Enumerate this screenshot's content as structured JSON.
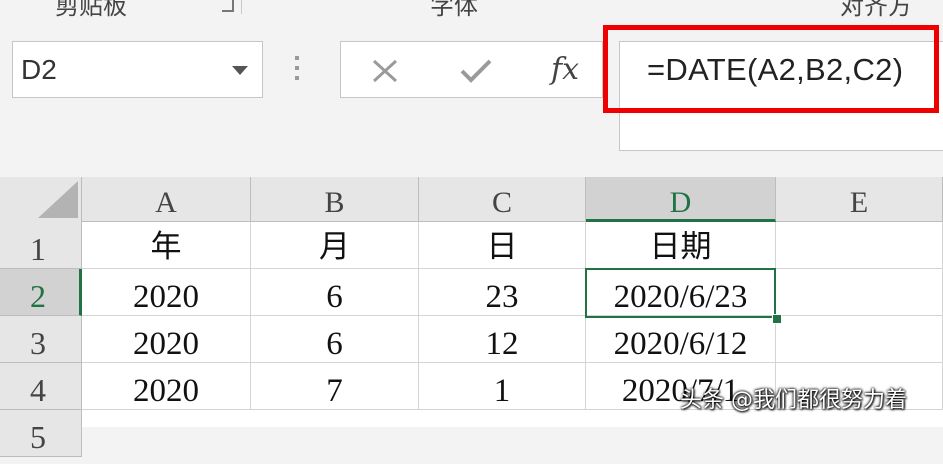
{
  "ribbon": {
    "group_clipboard": "剪贴板",
    "group_font": "字体",
    "group_align": "对齐方"
  },
  "name_box": {
    "value": "D2"
  },
  "formula_bar": {
    "cancel_icon": "x-icon",
    "enter_icon": "check-icon",
    "fx_label": "fx",
    "formula": "=DATE(A2,B2,C2)"
  },
  "sheet": {
    "columns": [
      "A",
      "B",
      "C",
      "D",
      "E"
    ],
    "rows": [
      "1",
      "2",
      "3",
      "4",
      "5"
    ],
    "selected_cell": "D2",
    "cells": [
      [
        "年",
        "月",
        "日",
        "日期",
        ""
      ],
      [
        "2020",
        "6",
        "23",
        "2020/6/23",
        ""
      ],
      [
        "2020",
        "6",
        "12",
        "2020/6/12",
        ""
      ],
      [
        "2020",
        "7",
        "1",
        "2020/7/1",
        ""
      ]
    ]
  },
  "watermark": "头条 @我们都很努力着",
  "colors": {
    "accent": "#217346",
    "highlight_box": "#ee0000"
  }
}
